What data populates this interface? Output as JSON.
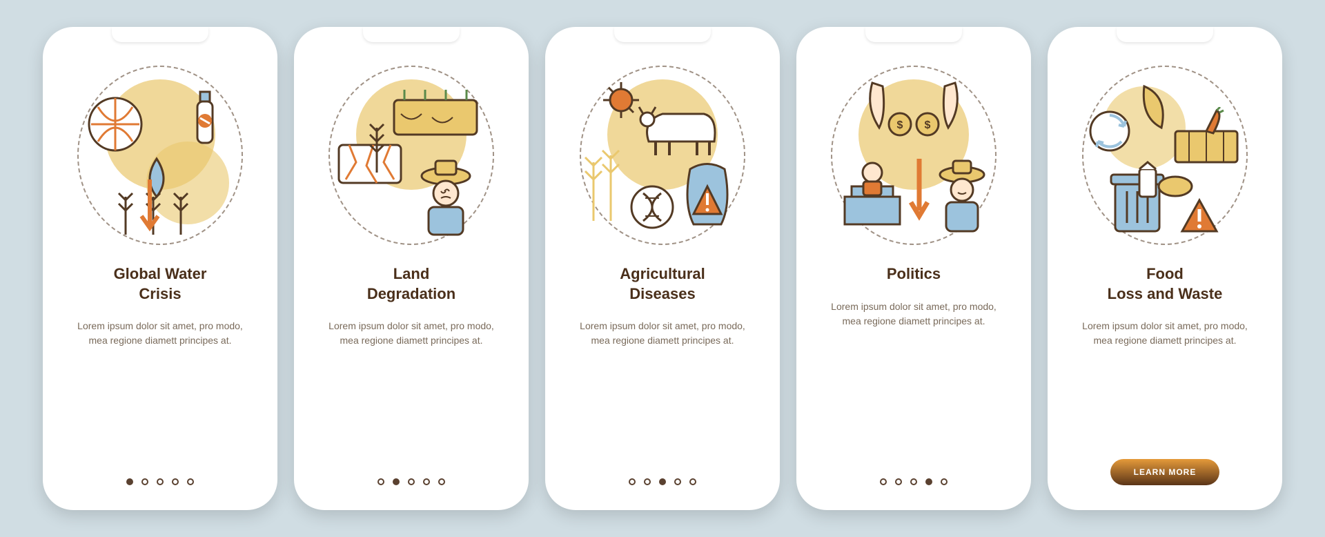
{
  "screens": [
    {
      "title": "Global Water\nCrisis",
      "desc": "Lorem ipsum dolor sit amet, pro modo, mea regione diamett principes at.",
      "activeDot": 0,
      "button": null
    },
    {
      "title": "Land\nDegradation",
      "desc": "Lorem ipsum dolor sit amet, pro modo, mea regione diamett principes at.",
      "activeDot": 1,
      "button": null
    },
    {
      "title": "Agricultural\nDiseases",
      "desc": "Lorem ipsum dolor sit amet, pro modo, mea regione diamett principes at.",
      "activeDot": 2,
      "button": null
    },
    {
      "title": "Politics",
      "desc": "Lorem ipsum dolor sit amet, pro modo, mea regione diamett principes at.",
      "activeDot": 3,
      "button": null
    },
    {
      "title": "Food\nLoss and Waste",
      "desc": "Lorem ipsum dolor sit amet, pro modo, mea regione diamett principes at.",
      "activeDot": 4,
      "button": "LEARN MORE"
    }
  ],
  "dotCount": 5,
  "colors": {
    "accentBrown": "#533a24",
    "accentYellow": "#eac86e",
    "accentOrange": "#e07a34",
    "accentBlue": "#9cc3dd"
  }
}
